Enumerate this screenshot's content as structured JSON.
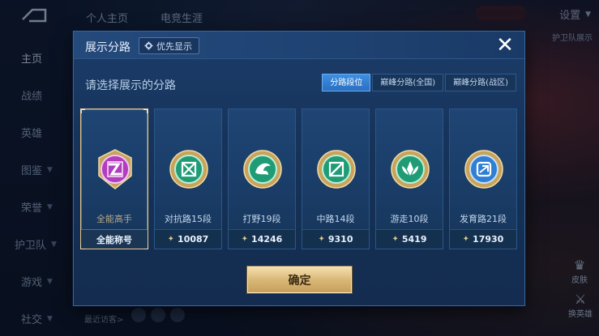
{
  "background": {
    "top_tabs": [
      "个人主页",
      "电竞生涯"
    ],
    "settings_label": "设置",
    "right_hint": "护卫队展示",
    "left_nav": [
      {
        "label": "主页",
        "active": true,
        "caret": false
      },
      {
        "label": "战绩",
        "active": false,
        "caret": false
      },
      {
        "label": "英雄",
        "active": false,
        "caret": false
      },
      {
        "label": "图鉴",
        "active": false,
        "caret": true
      },
      {
        "label": "荣誉",
        "active": false,
        "caret": true
      },
      {
        "label": "护卫队",
        "active": false,
        "caret": true
      },
      {
        "label": "游戏",
        "active": false,
        "caret": true
      },
      {
        "label": "社交",
        "active": false,
        "caret": true
      }
    ],
    "side_buttons": [
      "皮肤",
      "换英雄"
    ],
    "recent_label": "最近访客>"
  },
  "modal": {
    "title": "展示分路",
    "priority_label": "优先显示",
    "close_icon": "close-icon",
    "prompt": "请选择展示的分路",
    "tabs": [
      {
        "label": "分路段位",
        "active": true
      },
      {
        "label": "巅峰分路(全国)",
        "active": false
      },
      {
        "label": "巅峰分路(战区)",
        "active": false
      }
    ],
    "cards": [
      {
        "name": "全能高手",
        "foot": "全能称号",
        "points": null,
        "selected": true,
        "color": "#c64fd1",
        "icon": "allround-badge-icon"
      },
      {
        "name": "对抗路15段",
        "foot": null,
        "points": "10087",
        "selected": false,
        "color": "#2bb58a",
        "icon": "clash-lane-badge-icon"
      },
      {
        "name": "打野19段",
        "foot": null,
        "points": "14246",
        "selected": false,
        "color": "#2bb58a",
        "icon": "jungle-badge-icon"
      },
      {
        "name": "中路14段",
        "foot": null,
        "points": "9310",
        "selected": false,
        "color": "#2bb58a",
        "icon": "mid-lane-badge-icon"
      },
      {
        "name": "游走10段",
        "foot": null,
        "points": "5419",
        "selected": false,
        "color": "#2bb58a",
        "icon": "roam-badge-icon"
      },
      {
        "name": "发育路21段",
        "foot": null,
        "points": "17930",
        "selected": false,
        "color": "#3f8ee0",
        "icon": "farm-lane-badge-icon"
      }
    ],
    "confirm_label": "确定"
  }
}
